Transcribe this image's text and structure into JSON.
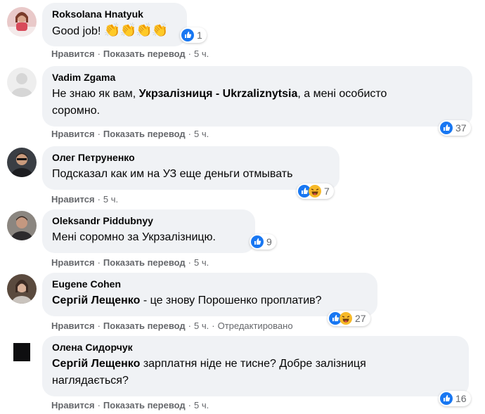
{
  "action_labels": {
    "like": "Нравится",
    "translate": "Показать перевод",
    "edited": "Отредактировано"
  },
  "comments": [
    {
      "author": "Roksolana Hnatyuk",
      "text": "Good job!",
      "emoji": "👏👏👏👏",
      "reactions": {
        "icons": [
          "like-icon"
        ],
        "count": "1"
      },
      "time": "5 ч."
    },
    {
      "author": "Vadim Zgama",
      "text_parts": [
        "Не знаю як вам, ",
        "Укрзалізниця - Ukrzaliznytsia",
        ", а мені особисто"
      ],
      "text_line2": "соромно.",
      "reactions": {
        "icons": [
          "like-icon"
        ],
        "count": "37"
      },
      "time": "5 ч."
    },
    {
      "author": "Олег Петруненко",
      "text": "Подсказал как им на УЗ еще деньги отмывать",
      "reactions": {
        "icons": [
          "like-icon",
          "haha-icon"
        ],
        "count": "7"
      },
      "time": "5 ч."
    },
    {
      "author": "Oleksandr Piddubnyy",
      "text": "Мені соромно за Укрзалізницю.",
      "reactions": {
        "icons": [
          "like-icon"
        ],
        "count": "9"
      },
      "time": "5 ч."
    },
    {
      "author": "Eugene Cohen",
      "mention": "Сергій Лещенко",
      "text": " - це знову Порошенко проплатив?",
      "reactions": {
        "icons": [
          "like-icon",
          "haha-icon"
        ],
        "count": "27"
      },
      "time": "5 ч."
    },
    {
      "author": "Олена Сидорчук",
      "mention": "Сергій Лещенко",
      "text": " зарплатня ніде не тисне? Добре залізниця",
      "text_line2": "наглядається?",
      "reactions": {
        "icons": [
          "like-icon"
        ],
        "count": "16"
      },
      "time": "5 ч."
    }
  ],
  "colors": {
    "bubble": "#f0f2f5",
    "meta_text": "#65676b",
    "like_blue": "#1877f2",
    "haha_yellow": "#f7b928"
  }
}
